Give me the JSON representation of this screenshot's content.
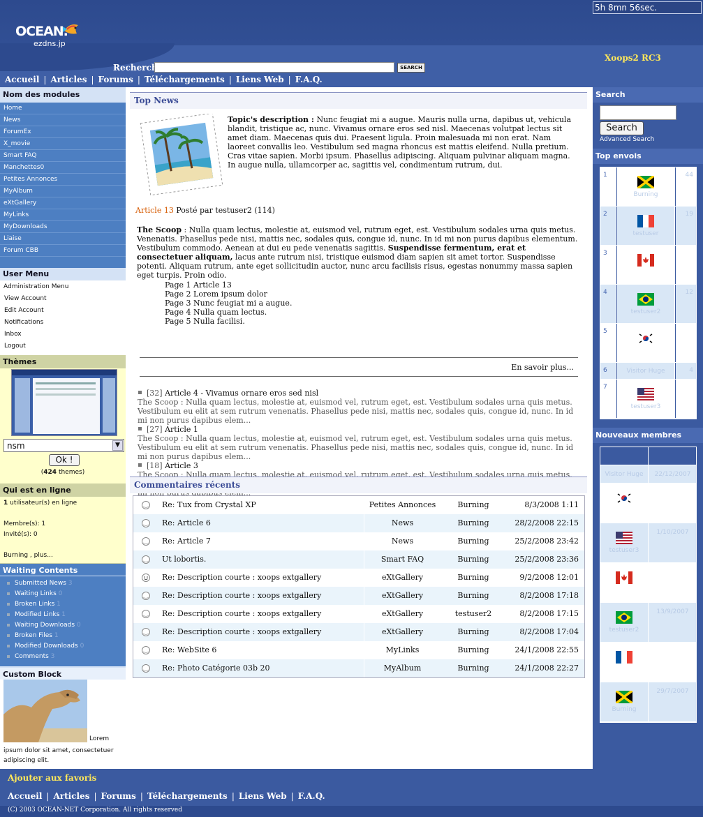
{
  "header": {
    "clock": "5h 8mn 56sec.",
    "logo_text": "OCEAN.",
    "logo_sub": "ezdns.jp",
    "version": "Xoops2 RC3",
    "search_label": "Recherche",
    "search_button": "SEARCH"
  },
  "nav": [
    "Accueil",
    "Articles",
    "Forums",
    "Téléchargements",
    "Liens Web",
    "F.A.Q."
  ],
  "left": {
    "modules_title": "Nom des modules",
    "modules": [
      "Home",
      "News",
      "ForumEx",
      "X_movie",
      "Smart FAQ",
      "Manchettes0",
      "Petites Annonces",
      "MyAlbum",
      "eXtGallery",
      "MyLinks",
      "MyDownloads",
      "Liaise",
      "Forum CBB"
    ],
    "usermenu_title": "User Menu",
    "usermenu": [
      "Administration Menu",
      "View Account",
      "Edit Account",
      "Notifications",
      "Inbox",
      "Logout"
    ],
    "themes_title": "Thèmes",
    "theme_selected": "nsm",
    "theme_button": "Ok !",
    "theme_count": "424",
    "theme_count_suffix": "themes)",
    "online_title": "Qui est en ligne",
    "online_users": "1",
    "online_users_suffix": "utilisateur(s) en ligne",
    "online_members": "Membre(s): 1",
    "online_guests": "Invité(s): 0",
    "online_list": "Burning , plus...",
    "waiting_title": "Waiting Contents",
    "waiting": [
      {
        "label": "Submitted News",
        "count": "3"
      },
      {
        "label": "Waiting Links",
        "count": "0"
      },
      {
        "label": "Broken Links",
        "count": "1"
      },
      {
        "label": "Modified Links",
        "count": "1"
      },
      {
        "label": "Waiting Downloads",
        "count": "0"
      },
      {
        "label": "Broken Files",
        "count": "1"
      },
      {
        "label": "Modified Downloads",
        "count": "0"
      },
      {
        "label": "Comments",
        "count": "3"
      }
    ],
    "custom_title": "Custom Block",
    "custom_text_inline": "Lorem",
    "custom_text": "ipsum dolor sit amet, consectetuer adipiscing elit."
  },
  "center": {
    "topnews_title": "Top News",
    "topic_label": "Topic's description :",
    "topic_text": "Nunc feugiat mi a augue. Mauris nulla urna, dapibus ut, vehicula blandit, tristique ac, nunc. Vivamus ornare eros sed nisl. Maecenas volutpat lectus sit amet diam. Maecenas quis dui. Praesent ligula. Proin malesuada mi non erat. Nam laoreet convallis leo. Vestibulum sed magna rhoncus est mattis eleifend. Nulla pretium. Cras vitae sapien. Morbi ipsum. Phasellus adipiscing. Aliquam pulvinar aliquam magna. In augue nulla, ullamcorper ac, sagittis vel, condimentum rutrum, dui.",
    "article_link": "Article 13",
    "article_meta": "Posté par testuser2 (114)",
    "scoop_label": "The Scoop",
    "scoop_text1": ": Nulla quam lectus, molestie at, euismod vel, rutrum eget, est. Vestibulum sodales urna quis metus. Venenatis. Phasellus pede nisi, mattis nec, sodales quis, congue id, nunc. In id mi non purus dapibus elementum. Vestibulum commodo. Aenean at dui eu pede venenatis sagittis.",
    "scoop_bold": "Suspendisse fermentum, erat et consectetuer aliquam,",
    "scoop_text2": "lacus ante rutrum nisi, tristique euismod diam sapien sit amet tortor. Suspendisse potenti. Aliquam rutrum, ante eget sollicitudin auctor, nunc arcu facilisis risus, egestas nonummy massa sapien eget turpis. Proin odio.",
    "pages": [
      "Page 1 Article 13",
      "Page 2 Lorem ipsum dolor",
      "Page 3 Nunc feugiat mi a augue.",
      "Page 4 Nulla quam lectus.",
      "Page 5 Nulla facilisi."
    ],
    "more": "En savoir plus...",
    "others": [
      {
        "num": "[32]",
        "title": "Article 4 - Vivamus ornare eros sed nisl",
        "desc": "The Scoop : Nulla quam lectus, molestie at, euismod vel, rutrum eget, est. Vestibulum sodales urna quis metus. Vestibulum eu elit at sem rutrum venenatis. Phasellus pede nisi, mattis nec, sodales quis, congue id, nunc. In id mi non purus dapibus elem..."
      },
      {
        "num": "[27]",
        "title": "Article 1",
        "desc": "The Scoop : Nulla quam lectus, molestie at, euismod vel, rutrum eget, est. Vestibulum sodales urna quis metus. Vestibulum eu elit at sem rutrum venenatis. Phasellus pede nisi, mattis nec, sodales quis, congue id, nunc. In id mi non purus dapibus elem..."
      },
      {
        "num": "[18]",
        "title": "Article 3",
        "desc": "The Scoop : Nulla quam lectus, molestie at, euismod vel, rutrum eget, est. Vestibulum sodales urna quis metus. Vestibulum eu elit at sem rutrum venenatis. Phasellus pede nisi, mattis nec, sodales quis, congue id, nunc. In id mi non purus dapibus elem..."
      }
    ],
    "comments_title": "Commentaires récents",
    "comments": [
      {
        "title": "Re: Tux from Crystal XP",
        "module": "Petites Annonces",
        "user": "Burning",
        "date": "8/3/2008 1:11",
        "icon": "circle-icon"
      },
      {
        "title": "Re: Article 6",
        "module": "News",
        "user": "Burning",
        "date": "28/2/2008 22:15",
        "icon": "circle-icon"
      },
      {
        "title": "Re: Article 7",
        "module": "News",
        "user": "Burning",
        "date": "25/2/2008 23:42",
        "icon": "circle-icon"
      },
      {
        "title": "Ut lobortis.",
        "module": "Smart FAQ",
        "user": "Burning",
        "date": "25/2/2008 23:36",
        "icon": "circle-icon"
      },
      {
        "title": "Re: Description courte : xoops extgallery",
        "module": "eXtGallery",
        "user": "Burning",
        "date": "9/2/2008 12:01",
        "icon": "smiley-icon"
      },
      {
        "title": "Re: Description courte : xoops extgallery",
        "module": "eXtGallery",
        "user": "Burning",
        "date": "8/2/2008 17:18",
        "icon": "circle-icon"
      },
      {
        "title": "Re: Description courte : xoops extgallery",
        "module": "eXtGallery",
        "user": "testuser2",
        "date": "8/2/2008 17:15",
        "icon": "circle-icon"
      },
      {
        "title": "Re: Description courte : xoops extgallery",
        "module": "eXtGallery",
        "user": "Burning",
        "date": "8/2/2008 17:04",
        "icon": "circle-icon"
      },
      {
        "title": "Re: WebSite 6",
        "module": "MyLinks",
        "user": "Burning",
        "date": "24/1/2008 22:55",
        "icon": "circle-icon"
      },
      {
        "title": "Re: Photo Catégorie 03b 20",
        "module": "MyAlbum",
        "user": "Burning",
        "date": "24/1/2008 22:27",
        "icon": "circle-icon"
      }
    ]
  },
  "right": {
    "search_title": "Search",
    "search_button": "Search",
    "advanced": "Advanced Search",
    "top_title": "Top envois",
    "top": [
      {
        "rank": "1",
        "flag": "jamaica",
        "name": "Burning",
        "count": "44"
      },
      {
        "rank": "2",
        "flag": "france",
        "name": "testuser",
        "count": "19"
      },
      {
        "rank": "3",
        "flag": "canada",
        "name": "",
        "count": ""
      },
      {
        "rank": "4",
        "flag": "brazil",
        "name": "testuser2",
        "count": "12"
      },
      {
        "rank": "5",
        "flag": "korea",
        "name": "",
        "count": ""
      },
      {
        "rank": "6",
        "flag": "",
        "name": "Visitor Huge",
        "count": "4"
      },
      {
        "rank": "7",
        "flag": "usa",
        "name": "testuser3",
        "count": ""
      }
    ],
    "new_title": "Nouveaux membres",
    "new": [
      {
        "flag": "",
        "name": "Visitor Huge",
        "date": "22/12/2007"
      },
      {
        "flag": "korea",
        "name": "",
        "date": ""
      },
      {
        "flag": "usa",
        "name": "testuser3",
        "date": "1/10/2007"
      },
      {
        "flag": "canada",
        "name": "",
        "date": ""
      },
      {
        "flag": "brazil",
        "name": "testuser2",
        "date": "13/9/2007"
      },
      {
        "flag": "france",
        "name": "",
        "date": ""
      },
      {
        "flag": "jamaica",
        "name": "Burning",
        "date": "29/7/2007"
      }
    ]
  },
  "footer": {
    "favorites": "Ajouter aux favoris",
    "copyright": "(C) 2003 OCEAN-NET Corporation. All rights reserved"
  },
  "colors": {
    "header": "#2d4a8e",
    "left": "#4d7fc2",
    "accent_yellow": "#ffe85a",
    "article_orange": "#d65a00"
  }
}
